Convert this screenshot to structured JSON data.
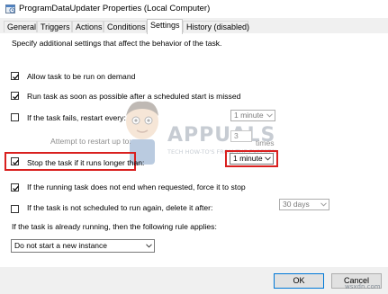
{
  "window": {
    "title": "ProgramDataUpdater Properties (Local Computer)"
  },
  "tabs": [
    {
      "label": "General"
    },
    {
      "label": "Triggers"
    },
    {
      "label": "Actions"
    },
    {
      "label": "Conditions"
    },
    {
      "label": "Settings"
    },
    {
      "label": "History (disabled)"
    }
  ],
  "settings": {
    "description": "Specify additional settings that affect the behavior of the task.",
    "allow_on_demand": {
      "label": "Allow task to be run on demand",
      "checked": true
    },
    "run_asap": {
      "label": "Run task as soon as possible after a scheduled start is missed",
      "checked": true
    },
    "restart_on_fail": {
      "label": "If the task fails, restart every:",
      "checked": false,
      "interval": "1 minute"
    },
    "restart_attempts": {
      "label": "Attempt to restart up to:",
      "value": "3",
      "unit": "times"
    },
    "stop_if_longer": {
      "label": "Stop the task if it runs longer than:",
      "checked": true,
      "value": "1 minute"
    },
    "force_stop": {
      "label": "If the running task does not end when requested, force it to stop",
      "checked": true
    },
    "delete_if_unscheduled": {
      "label": "If the task is not scheduled to run again, delete it after:",
      "checked": false,
      "value": "30 days"
    },
    "running_rule": {
      "label": "If the task is already running, then the following rule applies:",
      "value": "Do not start a new instance"
    }
  },
  "footer": {
    "ok_label": "OK",
    "cancel_label": "Cancel"
  },
  "watermark": {
    "brand": "APPUALS",
    "tagline": "TECH HOW-TO'S FROM THE EXPERTS!",
    "site": "wsxdn.com"
  },
  "colors": {
    "highlight": "#d9201f",
    "accent": "#0078d7"
  }
}
